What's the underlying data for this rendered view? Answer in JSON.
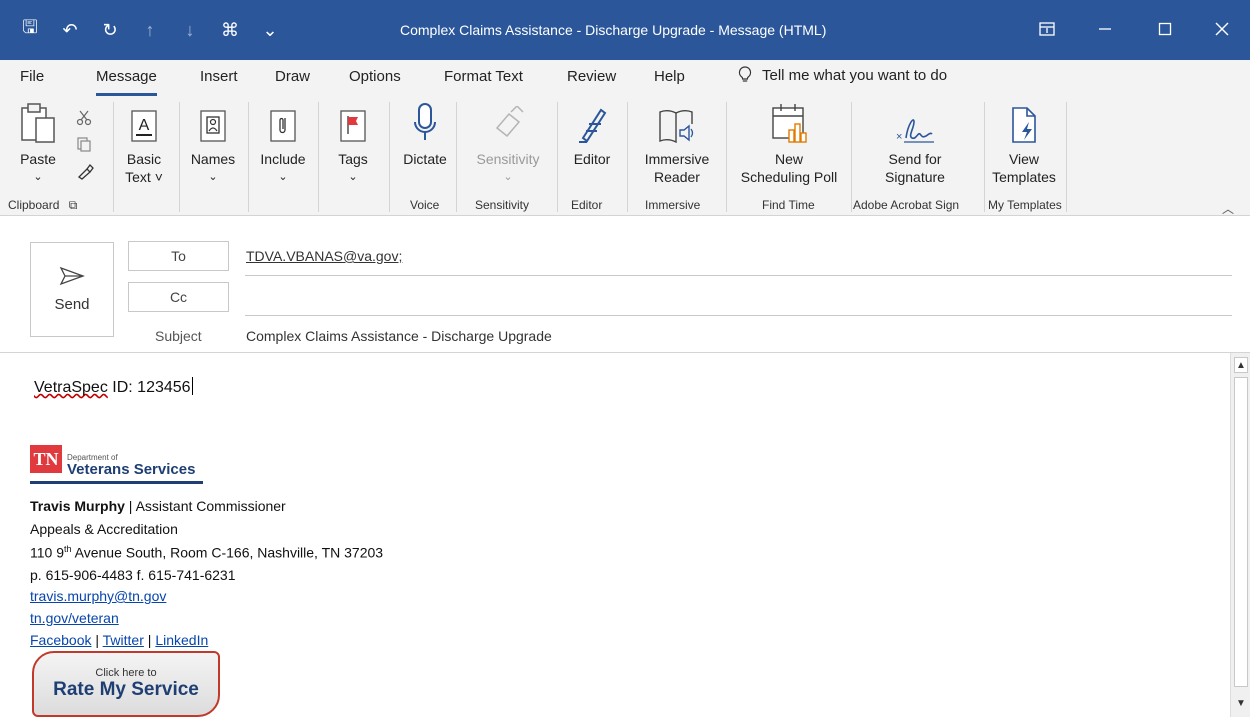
{
  "window": {
    "title": "Complex Claims Assistance - Discharge Upgrade  -  Message (HTML)"
  },
  "qat": [
    {
      "icon": "save-icon",
      "glyph": "🖫"
    },
    {
      "icon": "undo-icon",
      "glyph": "↶"
    },
    {
      "icon": "redo-icon",
      "glyph": "↻"
    },
    {
      "icon": "up-arrow-icon",
      "glyph": "↑"
    },
    {
      "icon": "down-arrow-icon",
      "glyph": "↓"
    },
    {
      "icon": "attach-icon",
      "glyph": "⌘"
    },
    {
      "icon": "customize-icon",
      "glyph": "⌄"
    }
  ],
  "menu": {
    "file": "File",
    "message": "Message",
    "insert": "Insert",
    "draw": "Draw",
    "options": "Options",
    "format_text": "Format Text",
    "review": "Review",
    "help": "Help",
    "tell_me": "Tell me what you want to do"
  },
  "ribbon": {
    "paste": "Paste",
    "basic_text": "Basic",
    "basic_text2": "Text ˅",
    "names": "Names",
    "include": "Include",
    "tags": "Tags",
    "dictate": "Dictate",
    "sensitivity": "Sensitivity",
    "editor": "Editor",
    "immersive_reader": "Immersive",
    "immersive_reader2": "Reader",
    "scheduling_poll": "New",
    "scheduling_poll2": "Scheduling Poll",
    "send_for_signature": "Send for",
    "send_for_signature2": "Signature",
    "view_templates": "View",
    "view_templates2": "Templates",
    "groups": {
      "clipboard": "Clipboard",
      "voice": "Voice",
      "sensitivity": "Sensitivity",
      "editor": "Editor",
      "immersive": "Immersive",
      "find_time": "Find Time",
      "adobe": "Adobe Acrobat Sign",
      "my_templates": "My Templates"
    }
  },
  "compose": {
    "send": "Send",
    "to_label": "To",
    "cc_label": "Cc",
    "subject_label": "Subject",
    "to_value": "TDVA.VBANAS@va.gov;",
    "subject_value": "Complex Claims Assistance - Discharge Upgrade"
  },
  "body": {
    "vetraspec_word": "VetraSpec",
    "vetraspec_rest": " ID: 123456",
    "logo_tn": "TN",
    "logo_dept": "Department of",
    "logo_vs": "Veterans Services",
    "name": "Travis Murphy",
    "title_sep": " | Assistant Commissioner",
    "division": "Appeals & Accreditation",
    "addr_num": "110  9",
    "addr_sup": "th",
    "addr_rest": " Avenue South, Room C-166, Nashville, TN 37203",
    "phone": "p. 615-906-4483 f. 615-741-6231",
    "email": "travis.murphy@tn.gov",
    "website": "tn.gov/veteran",
    "facebook": "Facebook",
    "twitter": "Twitter",
    "linkedin": "LinkedIn",
    "pipe": " | ",
    "rate_small": "Click here to",
    "rate_big": "Rate My Service"
  },
  "colors": {
    "titlebar": "#2b579a",
    "logo_red": "#e03a3e",
    "logo_navy": "#1f3f74",
    "link": "#0645ad"
  }
}
